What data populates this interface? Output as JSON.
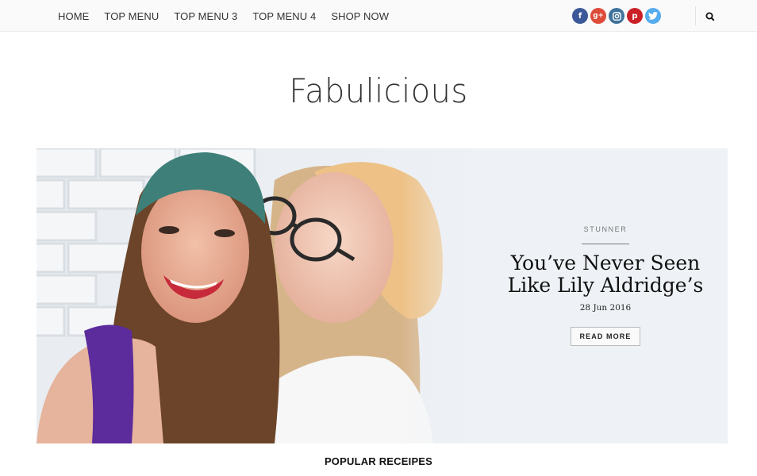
{
  "nav": {
    "items": [
      {
        "label": "HOME"
      },
      {
        "label": "TOP MENU"
      },
      {
        "label": "TOP MENU 3"
      },
      {
        "label": "TOP MENU 4"
      },
      {
        "label": "SHOP NOW"
      }
    ]
  },
  "social": [
    {
      "icon": "facebook-icon",
      "glyph": "f",
      "color": "#3b5998"
    },
    {
      "icon": "google-plus-icon",
      "glyph": "g+",
      "color": "#dd4b39"
    },
    {
      "icon": "instagram-icon",
      "glyph": "",
      "color": "#3f729b"
    },
    {
      "icon": "pinterest-icon",
      "glyph": "p",
      "color": "#cb2027"
    },
    {
      "icon": "twitter-icon",
      "glyph": "",
      "color": "#55acee"
    }
  ],
  "search": {
    "icon": "search-icon"
  },
  "site": {
    "logo": "Fabulicious"
  },
  "hero": {
    "category": "STUNNER",
    "title_line1": "You’ve Never Seen",
    "title_line2": "Like Lily Aldridge’s",
    "date": "28 Jun 2016",
    "button": "READ MORE"
  },
  "section": {
    "title": "POPULAR RECEIPES"
  }
}
